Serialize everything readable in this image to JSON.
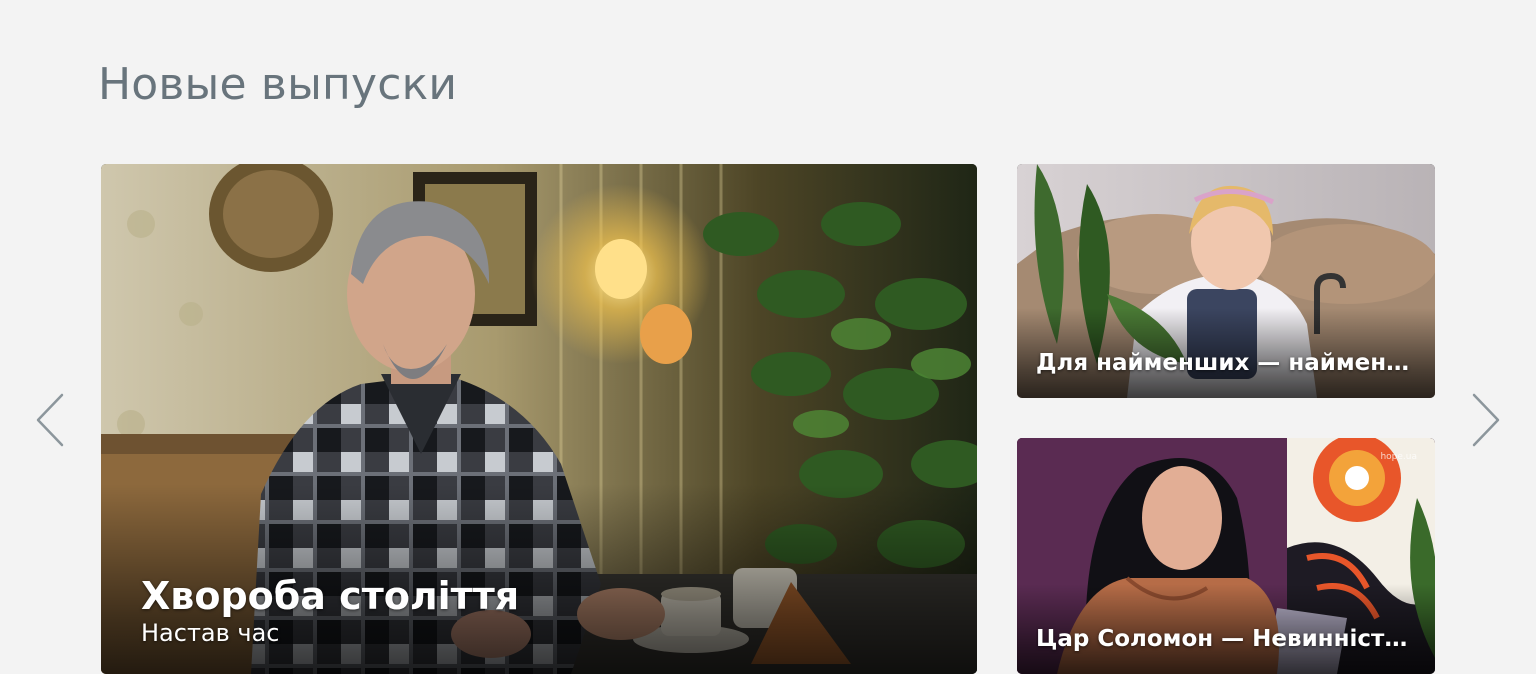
{
  "section": {
    "title": "Новые выпуски"
  },
  "navigation": {
    "prev_icon": "chevron-left-icon",
    "next_icon": "chevron-right-icon",
    "arrow_color": "#8c969c"
  },
  "episodes": [
    {
      "title": "Хвороба століття",
      "program": "Настав час"
    },
    {
      "title": "Для найменших — найменше?"
    },
    {
      "title": "Цар Соломон — Невинність...",
      "watermark": "hope.ua"
    }
  ]
}
